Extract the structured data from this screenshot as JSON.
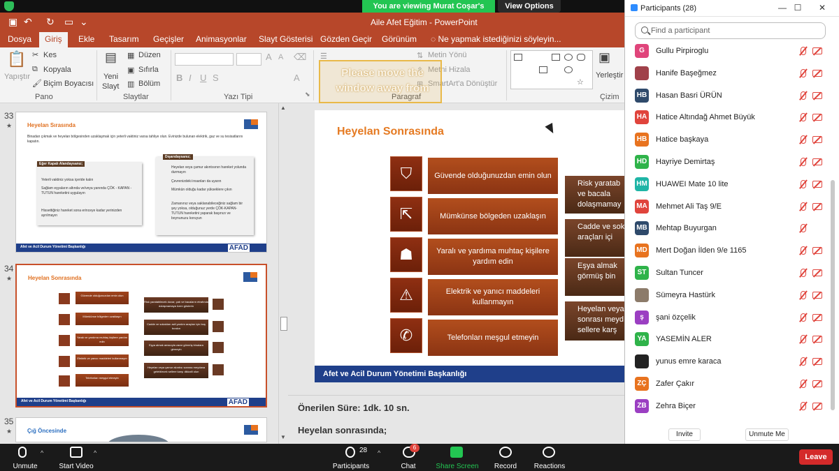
{
  "zoom_banner": {
    "viewing": "You are viewing Murat Coşar's screen",
    "view_options": "View Options"
  },
  "ppt": {
    "doc_title": "Aile Afet Eğitim - PowerPoint",
    "tabs": [
      "Dosya",
      "Giriş",
      "Ekle",
      "Tasarım",
      "Geçişler",
      "Animasyonlar",
      "Slayt Gösterisi",
      "Gözden Geçir",
      "Görünüm"
    ],
    "tell_me": "Ne yapmak istediğinizi söyleyin...",
    "ribbon": {
      "paste": "Yapıştır",
      "cut": "Kes",
      "copy": "Kopyala",
      "format_painter": "Biçim Boyacısı",
      "group_clipboard": "Pano",
      "new_slide_1": "Yeni",
      "new_slide_2": "Slayt",
      "layout": "Düzen",
      "reset": "Sıfırla",
      "section": "Bölüm",
      "group_slides": "Slaytlar",
      "group_font": "Yazı Tipi",
      "text_direction": "Metin Yönü",
      "align_text": "Metni Hizala",
      "smartart": "SmartArt'a Dönüştür",
      "group_paragraph": "Paragraf",
      "arrange": "Yerleştir",
      "group_drawing": "Çizim"
    },
    "ghost_text": "Please move the window away from"
  },
  "thumbs": [
    {
      "num": "33",
      "title": "Heyelan Sırasında",
      "intro": "Binadan çıkmak ve heyelan bölgesinden uzaklaşmak için yeterli vaktiniz varsa tahliye olun. Evinizde bulunan elektrik, gaz ve su tesisatlarını kapatın.",
      "box1_head": "Eğer Kapalı Alandaysanız;",
      "box1_items": [
        "Yeterli vaktiniz yoksa içeride kalın",
        "Sağlam eşyaların altında ve/veya yanında ÇÖK - KAPAN - TUTUN hareketini uygulayın",
        "Hissettiğiniz hareket sona erinceye kadar yerinizden ayrılmayın"
      ],
      "box2_head": "Dışarıdaysanız;",
      "box2_items": [
        "Heyelan veya çamur akıntısının hareket yolunda durmayın",
        "Çevrenizdeki insanları da uyarın",
        "Mümkün olduğu kadar yükseklere çıkın",
        "Zamanınız veya saklanabileceğiniz sağlam bir şey yoksa, olduğunuz yerde ÇÖK-KAPAN-TUTUN hareketini yaparak başınızı ve boynunuzu koruyun"
      ],
      "footer": "Afet ve Acil Durum Yönetimi Başkanlığı",
      "brand": "AFAD"
    },
    {
      "num": "34",
      "title": "Heyelan Sonrasında",
      "bars": [
        "Güvende olduğunuzdan emin olun",
        "Mümkünse bölgeden uzaklaşın",
        "Yaralı ve yardıma muhtaç kişilere yardım edin",
        "Elektrik ve yanıcı maddeleri kullanmayın",
        "Telefonları meşgul etmeyin"
      ],
      "cards": [
        "Risk yaratabilecek duvar, çatı ve bacaların etrafında dolaşmamaya özen gösterin",
        "Cadde ve sokakları acil yardım araçları için boş bırakın",
        "Eşya almak amacıyla zarar görmüş binalara girmeyin",
        "Heyelan veya çamur akıntısı sonrası meydana gelebilecek sellere karşı dikkatli olun"
      ],
      "footer": "Afet ve Acil Durum Yönetimi Başkanlığı",
      "brand": "AFAD"
    },
    {
      "num": "35",
      "title": "Çığ Öncesinde"
    }
  ],
  "main_slide": {
    "title": "Heyelan Sonrasında",
    "bars": [
      "Güvende olduğunuzdan emin olun",
      "Mümkünse bölgeden uzaklaşın",
      "Yaralı ve yardıma muhtaç kişilere yardım edin",
      "Elektrik ve yanıcı maddeleri kullanmayın",
      "Telefonları meşgul etmeyin"
    ],
    "cards": [
      "Risk yaratab ve bacala dolaşmamay",
      "Cadde ve sok araçları içi",
      "Eşya almak görmüş bin",
      "Heyelan veya sonrası meyd sellere karş"
    ],
    "footer": "Afet ve Acil Durum Yönetimi Başkanlığı"
  },
  "notes": {
    "line1": "Önerilen Süre: 1dk. 10 sn.",
    "line2": "Heyelan sonrasında;"
  },
  "participants_panel": {
    "title": "Participants (28)",
    "search_placeholder": "Find a participant",
    "invite": "Invite",
    "unmute_me": "Unmute Me",
    "list": [
      {
        "initials": "G",
        "name": "Gullu Pirpiroglu",
        "color": "#e0457b"
      },
      {
        "initials": "",
        "name": "Hanife Başeğmez",
        "color": "#a0414a"
      },
      {
        "initials": "HB",
        "name": "Hasan Basri ÜRÜN",
        "color": "#2f4a6b"
      },
      {
        "initials": "HA",
        "name": "Hatice Altındağ Ahmet Büyük",
        "color": "#e0443c"
      },
      {
        "initials": "HB",
        "name": "Hatice başkaya",
        "color": "#e8731f"
      },
      {
        "initials": "HD",
        "name": "Hayriye Demirtaş",
        "color": "#2fb34a"
      },
      {
        "initials": "HM",
        "name": "HUAWEI Mate 10 lite",
        "color": "#1fb5a6"
      },
      {
        "initials": "MA",
        "name": "Mehmet Ali Taş 9/E",
        "color": "#e0443c"
      },
      {
        "initials": "MB",
        "name": "Mehtap Buyurgan",
        "color": "#2f4a6b"
      },
      {
        "initials": "MD",
        "name": "Mert Doğan İlden 9/e 1165",
        "color": "#e8731f"
      },
      {
        "initials": "ST",
        "name": "Sultan Tuncer",
        "color": "#2fb34a"
      },
      {
        "initials": "",
        "name": "Sümeyra Hastürk",
        "color": "#8c7b6a"
      },
      {
        "initials": "ş",
        "name": "şani özçelik",
        "color": "#9b3fc2"
      },
      {
        "initials": "YA",
        "name": "YASEMİN  ALER",
        "color": "#2fb34a"
      },
      {
        "initials": "",
        "name": "yunus emre karaca",
        "color": "#222222"
      },
      {
        "initials": "ZÇ",
        "name": "Zafer Çakır",
        "color": "#e8731f"
      },
      {
        "initials": "ZB",
        "name": "Zehra Biçer",
        "color": "#9b3fc2"
      }
    ]
  },
  "zoom_toolbar": {
    "unmute": "Unmute",
    "start_video": "Start Video",
    "participants": "Participants",
    "participants_count": "28",
    "chat": "Chat",
    "chat_badge": "6",
    "share_screen": "Share Screen",
    "record": "Record",
    "reactions": "Reactions",
    "leave": "Leave"
  }
}
